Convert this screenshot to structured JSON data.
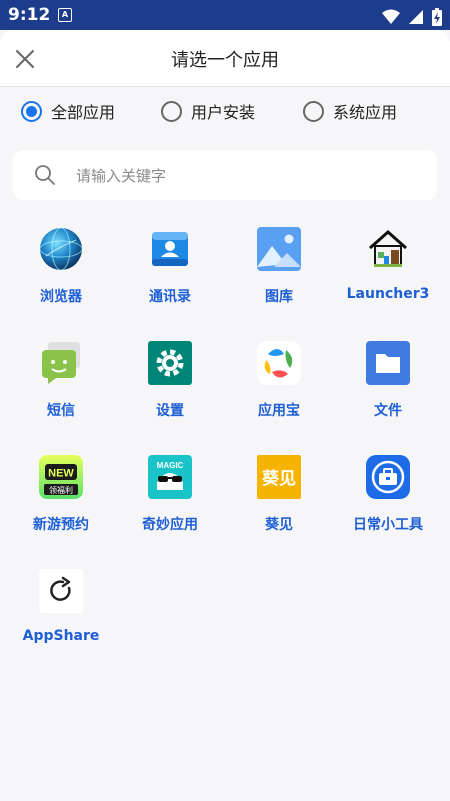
{
  "status_bar": {
    "time": "9:12",
    "notification_icon": "a-notification-icon",
    "icons": [
      "wifi-icon",
      "signal-icon",
      "battery-icon"
    ]
  },
  "header": {
    "title": "请选一个应用",
    "close_icon": "close-icon"
  },
  "filters": [
    {
      "label": "全部应用",
      "checked": true
    },
    {
      "label": "用户安装",
      "checked": false
    },
    {
      "label": "系统应用",
      "checked": false
    }
  ],
  "search": {
    "placeholder": "请输入关键字",
    "icon": "search-icon"
  },
  "apps": [
    {
      "name": "浏览器",
      "icon": "browser-icon"
    },
    {
      "name": "通讯录",
      "icon": "contacts-icon"
    },
    {
      "name": "图库",
      "icon": "gallery-icon"
    },
    {
      "name": "Launcher3",
      "icon": "launcher-icon"
    },
    {
      "name": "短信",
      "icon": "sms-icon"
    },
    {
      "name": "设置",
      "icon": "settings-icon"
    },
    {
      "name": "应用宝",
      "icon": "appstore-icon"
    },
    {
      "name": "文件",
      "icon": "files-icon"
    },
    {
      "name": "新游预约",
      "icon": "new-game-icon",
      "badge_lines": [
        "NEW",
        "领福利"
      ]
    },
    {
      "name": "奇妙应用",
      "icon": "magic-app-icon",
      "badge_text": "MAGIC"
    },
    {
      "name": "葵见",
      "icon": "kuijian-icon",
      "badge_text": "葵见"
    },
    {
      "name": "日常小工具",
      "icon": "toolbox-icon"
    },
    {
      "name": "AppShare",
      "icon": "appshare-icon"
    }
  ],
  "colors": {
    "status_bar": "#1d3d8c",
    "accent": "#1a73e8",
    "app_label": "#1e5fd6",
    "background": "#f6f6f8"
  }
}
